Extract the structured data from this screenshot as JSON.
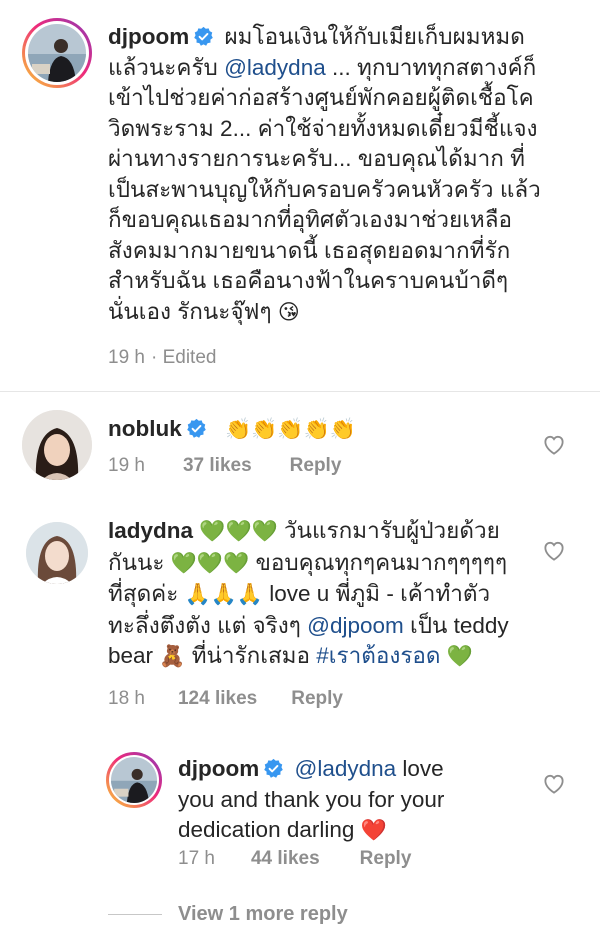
{
  "comments": [
    {
      "username": "djpoom",
      "lines": [
        "ผมโอนเงินให้กับเมียเก็บผมหมด",
        "แล้วนะครับ ",
        "เข้าไปช่วยค่าก่อสร้างศูนย์พักคอยผู้ติดเชื้อโค",
        "วิดพระราม 2... ค่าใช้จ่ายทั้งหมดเดี๋ยวมีชี้แจง",
        "ผ่านทางรายการนะครับ... ขอบคุณได้มาก ที่",
        "เป็นสะพานบุญให้กับครอบครัวคนหัวครัว แล้ว",
        "ก็ขอบคุณเธอมากที่อุทิศตัวเองมาช่วยเหลือ",
        "สังคมมากมายขนาดนี้ เธอสุดยอดมากที่รัก",
        "สำหรับฉัน เธอคือนางฟ้าในคราบคนบ้าดีๆ",
        "นั่นเอง รักนะจุ๊ฟๆ"
      ],
      "mention": "@ladydna",
      "line2_tail": " ... ทุกบาททุกสตางค์ก็",
      "emoji_end": "😘",
      "time": "19 h",
      "edited": "· Edited"
    },
    {
      "username": "nobluk",
      "emoji": "👏👏👏👏👏",
      "time": "19 h",
      "likes": "37 likes",
      "reply": "Reply"
    },
    {
      "username": "ladydna",
      "line1_emoji": "💚💚💚",
      "line1_text": "วันแรกมารับผู้ป่วยด้วย",
      "line2_pre": "กันนะ ",
      "line2_emoji": "💚💚💚",
      "line2_text": " ขอบคุณทุกๆคนมากๆๆๆๆๆ",
      "line3_pre": "ที่สุดค่ะ ",
      "line3_emoji": "🙏🙏🙏",
      "line3_text": " love u พี่ภูมิ - เค้าทำตัว",
      "line4_pre": "ทะลึ่งตึงตัง แต่ จริงๆ ",
      "line4_mention": "@djpoom",
      "line4_text": "  เป็น teddy",
      "line5_pre": "bear ",
      "line5_emoji": "🧸",
      "line5_text": " ที่น่ารักเสมอ ",
      "line5_hashtag": "#เราต้องรอด",
      "line5_emoji2": "💚",
      "time": "18 h",
      "likes": "124 likes",
      "reply": "Reply"
    },
    {
      "username": "djpoom",
      "mention": "@ladydna",
      "line1_text": " love",
      "line2": "you and thank you for your",
      "line3": "dedication darling ",
      "emoji_end": "❤️",
      "time": "17 h",
      "likes": "44 likes",
      "reply": "Reply"
    }
  ],
  "view_more": "View 1 more reply",
  "colors": {
    "text": "#262626",
    "muted": "#8e8e8e",
    "link": "#1f4f8c",
    "verified": "#3897f0"
  }
}
